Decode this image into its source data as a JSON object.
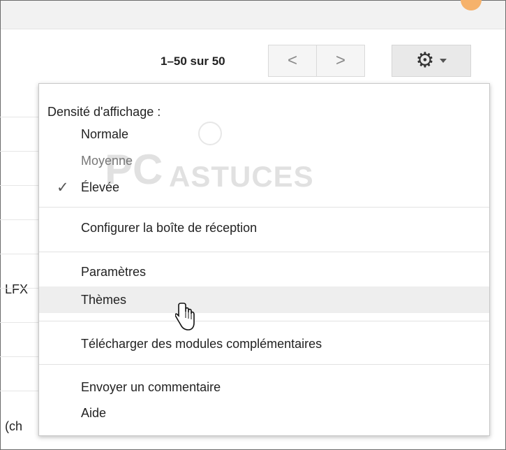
{
  "toolbar": {
    "pagination_text": "1–50 sur 50",
    "prev_label": "<",
    "next_label": ">",
    "settings_icon": "gear-icon"
  },
  "background_rows": {
    "text_1": "LFX",
    "text_2": "(ch"
  },
  "menu": {
    "density_header": "Densité d'affichage :",
    "density_options": [
      {
        "label": "Normale",
        "selected": false
      },
      {
        "label": "Moyenne",
        "selected": false
      },
      {
        "label": "Élevée",
        "selected": true
      }
    ],
    "configure_inbox": "Configurer la boîte de réception",
    "settings": "Paramètres",
    "themes": "Thèmes",
    "download_modules": "Télécharger des modules complémentaires",
    "send_feedback": "Envoyer un commentaire",
    "help": "Aide"
  },
  "watermark": {
    "pc": "PC",
    "astuces": "ASTUCES"
  },
  "colors": {
    "menu_hover": "#eeeeee",
    "muted_text": "#777777"
  }
}
